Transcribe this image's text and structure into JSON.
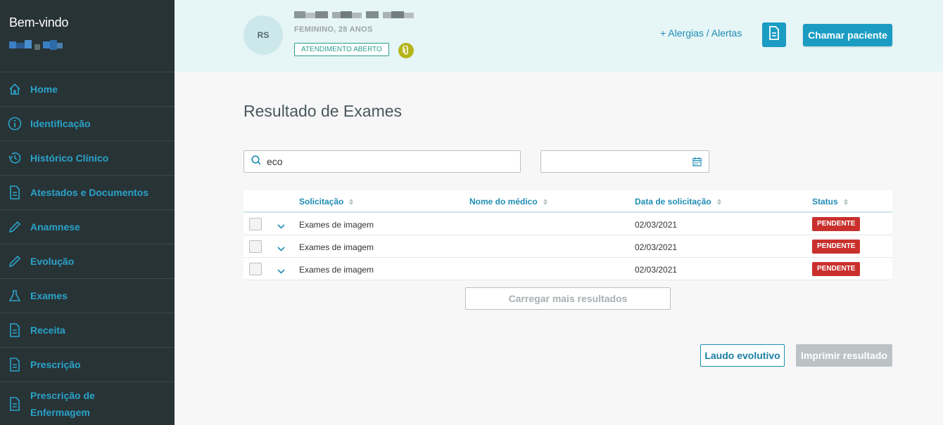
{
  "sidebar": {
    "welcome": "Bem-vindo",
    "items": [
      {
        "label": "Home",
        "icon": "home-icon"
      },
      {
        "label": "Identificação",
        "icon": "info-icon"
      },
      {
        "label": "Histórico Clínico",
        "icon": "history-icon"
      },
      {
        "label": "Atestados e Documentos",
        "icon": "document-icon"
      },
      {
        "label": "Anamnese",
        "icon": "pencil-icon"
      },
      {
        "label": "Evolução",
        "icon": "pencil-icon"
      },
      {
        "label": "Exames",
        "icon": "flask-icon"
      },
      {
        "label": "Receita",
        "icon": "document-icon"
      },
      {
        "label": "Prescrição",
        "icon": "document-icon"
      },
      {
        "label": "Prescrição de Enfermagem",
        "icon": "document-icon"
      }
    ]
  },
  "patient": {
    "initials": "RS",
    "info": "FEMININO, 28 ANOS",
    "status_badge": "ATENDIMENTO ABERTO"
  },
  "header": {
    "alerts_link": "+ Alergias / Alertas",
    "call_button": "Chamar paciente"
  },
  "main": {
    "title": "Resultado de Exames",
    "search": {
      "value": "eco",
      "placeholder": ""
    },
    "date": {
      "value": ""
    },
    "table": {
      "columns": [
        "Solicitação",
        "Nome do médico",
        "Data de solicitação",
        "Status"
      ],
      "rows": [
        {
          "solicitacao": "Exames de imagem",
          "medico": "",
          "data": "02/03/2021",
          "status": "PENDENTE"
        },
        {
          "solicitacao": "Exames de imagem",
          "medico": "",
          "data": "02/03/2021",
          "status": "PENDENTE"
        },
        {
          "solicitacao": "Exames de imagem",
          "medico": "",
          "data": "02/03/2021",
          "status": "PENDENTE"
        }
      ]
    },
    "load_more": "Carregar mais resultados",
    "laudo_button": "Laudo evolutivo",
    "print_button": "Imprimir resultado"
  },
  "colors": {
    "sidebar_bg": "#283336",
    "accent": "#1a9cc3",
    "header_bg": "#e6f5f6",
    "pending": "#c9302c"
  }
}
